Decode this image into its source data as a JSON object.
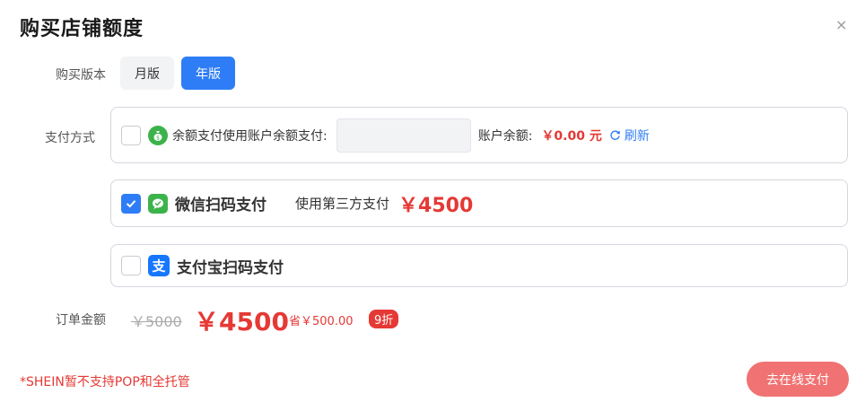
{
  "title": "购买店铺额度",
  "close_symbol": "×",
  "version": {
    "label": "购买版本",
    "options": [
      "月版",
      "年版"
    ],
    "selected": "年版"
  },
  "payment": {
    "label": "支付方式",
    "balance": {
      "text": "余额支付使用账户余额支付:",
      "input_value": "",
      "account_label": "账户余额:",
      "account_value": "￥0.00 元",
      "refresh_label": "刷新",
      "checked": false,
      "icon": "money-bag-icon"
    },
    "wechat": {
      "name": "微信扫码支付",
      "third_party": "使用第三方支付",
      "price": "￥4500",
      "checked": true,
      "icon": "wechat-icon"
    },
    "alipay": {
      "name": "支付宝扫码支付",
      "checked": false,
      "icon": "alipay-icon"
    }
  },
  "order": {
    "label": "订单金额",
    "original_price": "￥5000",
    "final_price": "￥4500",
    "save": "省￥500.00",
    "discount": "9折"
  },
  "notice": "*SHEIN暂不支持POP和全托管",
  "submit_label": "去在线支付",
  "colors": {
    "accent": "#2f7df6",
    "price_red": "#e53935",
    "submit_bg": "#f07272",
    "wechat_green": "#3cb34a",
    "alipay_blue": "#1677ff"
  }
}
